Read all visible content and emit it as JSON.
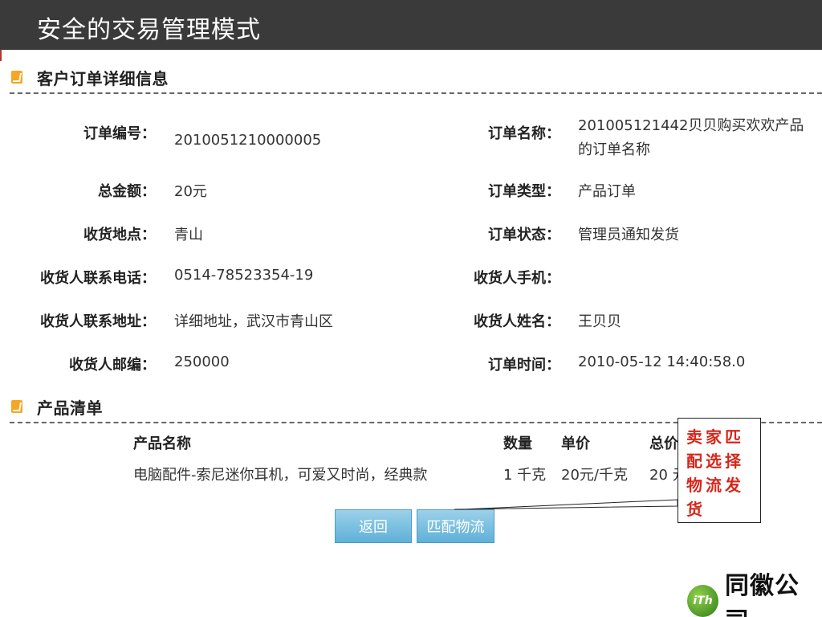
{
  "slide_title": "安全的交易管理模式",
  "order_section": {
    "heading": "客户订单详细信息",
    "left": [
      {
        "label": "订单编号：",
        "value": "2010051210000005"
      },
      {
        "label": "总金额：",
        "value": "20元"
      },
      {
        "label": "收货地点：",
        "value": "青山"
      },
      {
        "label": "收货人联系电话：",
        "value": "0514-78523354-19"
      },
      {
        "label": "收货人联系地址：",
        "value": "详细地址，武汉市青山区"
      },
      {
        "label": "收货人邮编：",
        "value": "250000"
      }
    ],
    "right": [
      {
        "label": "订单名称：",
        "value": "201005121442贝贝购买欢欢产品的订单名称"
      },
      {
        "label": "订单类型：",
        "value": "产品订单"
      },
      {
        "label": "订单状态：",
        "value": "管理员通知发货"
      },
      {
        "label": "收货人手机：",
        "value": ""
      },
      {
        "label": "收货人姓名：",
        "value": "王贝贝"
      },
      {
        "label": "订单时间：",
        "value": "2010-05-12 14:40:58.0"
      }
    ]
  },
  "product_section": {
    "heading": "产品清单",
    "columns": {
      "name": "产品名称",
      "qty": "数量",
      "price": "单价",
      "total": "总价"
    },
    "rows": [
      {
        "name": "电脑配件-索尼迷你耳机，可爱又时尚，经典款",
        "qty": "1 千克",
        "price": "20元/千克",
        "total": "20 元"
      }
    ]
  },
  "buttons": {
    "back": "返回",
    "match_logistics": "匹配物流"
  },
  "callout": "卖家匹配选择物流发货",
  "logo": {
    "mark": "iTh",
    "name": "同徽公司"
  },
  "colors": {
    "title_bar": "#3a3a3a",
    "section_icon": "#f5a623",
    "button": "#6cb8df",
    "callout_text": "#d4281c",
    "logo_green": "#4aa52a"
  }
}
